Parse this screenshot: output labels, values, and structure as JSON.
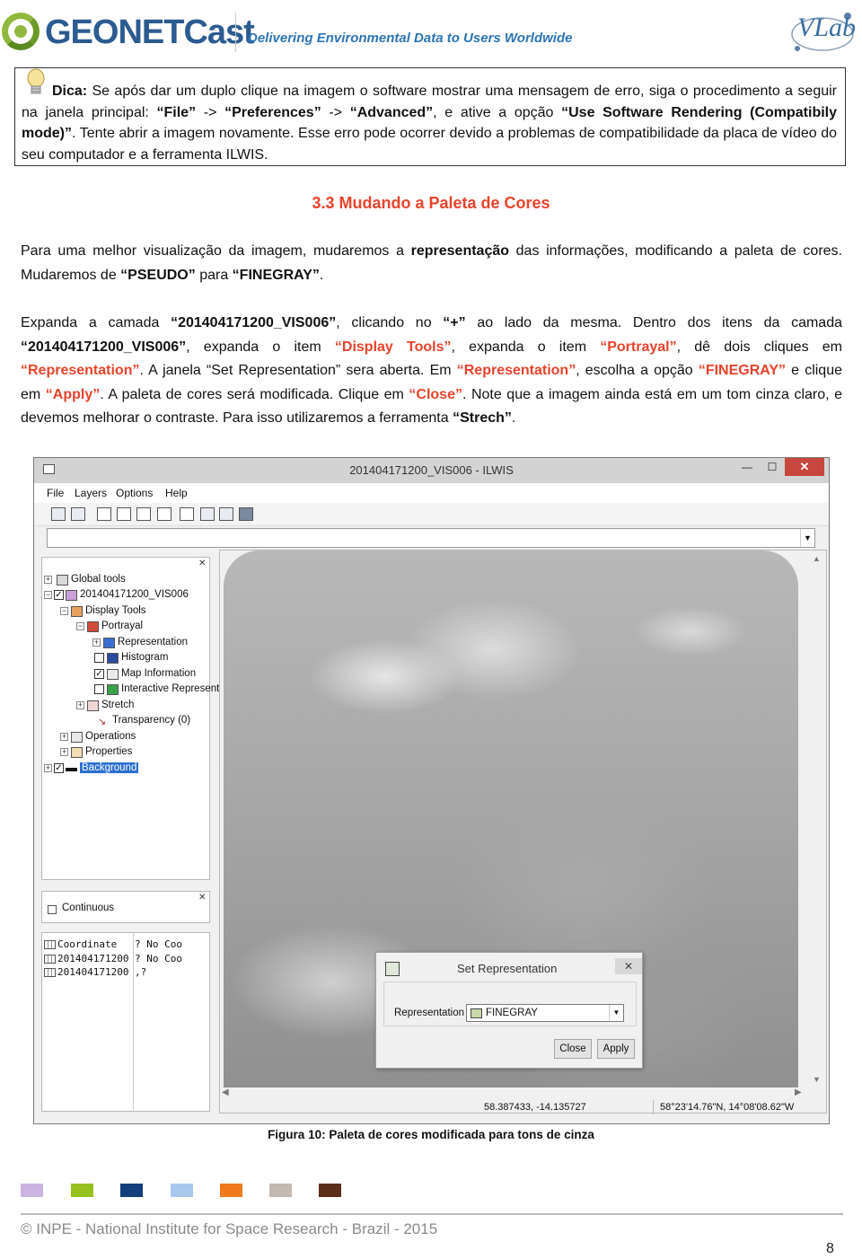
{
  "header": {
    "logo_text": "GEONETCast",
    "tagline": "Delivering Environmental Data to Users Worldwide",
    "right_logo": "VLab"
  },
  "tip": {
    "label": "Dica:",
    "t1": " Se após dar um duplo clique na imagem o software mostrar uma mensagem de erro, siga o procedimento a seguir na janela principal: ",
    "file": "“File”",
    "arrow1": " -> ",
    "prefs": "“Preferences”",
    "arrow2": " -> ",
    "advanced": "“Advanced”",
    "t2": ", e ative a opção ",
    "option": "“Use Software Rendering (Compatibily mode)”",
    "t3": ". Tente abrir a imagem novamente. Esse erro pode ocorrer devido a problemas de compatibilidade da placa de vídeo do seu computador e a ferramenta ILWIS."
  },
  "section_title": "3.3 Mudando a Paleta de Cores",
  "para1": {
    "t1": "Para uma melhor visualização da imagem, mudaremos a ",
    "b1": "representação",
    "t2": " das informações, modificando a paleta de cores. Mudaremos de ",
    "b2": "“PSEUDO”",
    "t3": " para ",
    "b3": "“FINEGRAY”",
    "t4": "."
  },
  "para2": {
    "t1": "Expanda a camada ",
    "b1": "“201404171200_VIS006”",
    "t2": ", clicando no ",
    "b2": "“+”",
    "t3": " ao lado da mesma. Dentro dos itens da camada ",
    "b3": "“201404171200_VIS006”",
    "t4": ", expanda o item ",
    "h1": "“Display Tools”",
    "t5": ", expanda o item ",
    "h2": "“Portrayal”",
    "t6": ", dê dois cliques em ",
    "h3": "“Representation”",
    "t7": ". A janela “Set Representation” sera aberta. Em ",
    "h4": "“Representation”",
    "t8": ", escolha a opção ",
    "h5": "“FINEGRAY”",
    "t9": " e clique em ",
    "h6": "“Apply”",
    "t10": ". A paleta de cores será modificada. Clique em ",
    "h7": "“Close”",
    "t11": ". Note que a imagem ainda está em um tom cinza claro, e devemos melhorar o contraste. Para isso utilizaremos a ferramenta ",
    "b4": "“Strech”",
    "t12": "."
  },
  "screenshot": {
    "window_title": "201404171200_VIS006 - ILWIS",
    "min": "—",
    "max": "☐",
    "close": "✕",
    "menu": [
      "File",
      "Layers",
      "Options",
      "Help"
    ],
    "tree": [
      {
        "label": "Global tools"
      },
      {
        "label": "201404171200_VIS006"
      },
      {
        "label": "Display Tools"
      },
      {
        "label": "Portrayal"
      },
      {
        "label": "Representation"
      },
      {
        "label": "Histogram"
      },
      {
        "label": "Map Information"
      },
      {
        "label": "Interactive Represent"
      },
      {
        "label": "Stretch"
      },
      {
        "label": "Transparency (0)"
      },
      {
        "label": "Operations"
      },
      {
        "label": "Properties"
      },
      {
        "label": "Background"
      }
    ],
    "continuous_label": "Continuous",
    "coords": [
      {
        "name": "Coordinate",
        "value": "? No Coo"
      },
      {
        "name": "201404171200",
        "value": "? No Coo"
      },
      {
        "name": "201404171200",
        "value": ",?"
      }
    ],
    "status_left": "58.387433, -14.135727",
    "status_right": "58°23'14.76\"N, 14°08'08.62\"W",
    "dialog": {
      "title": "Set Representation",
      "close": "✕",
      "field_label": "Representation",
      "field_value": "FINEGRAY",
      "close_btn": "Close",
      "apply_btn": "Apply"
    }
  },
  "caption": "Figura 10: Paleta de cores modificada para tons de cinza",
  "swatches": [
    "#c9b4e0",
    "#96c11f",
    "#123e7c",
    "#a9c8ee",
    "#f07a1c",
    "#c3b9b1",
    "#5a2e1a"
  ],
  "footer": "© INPE - National Institute for Space Research - Brazil - 2015",
  "page_number": "8"
}
